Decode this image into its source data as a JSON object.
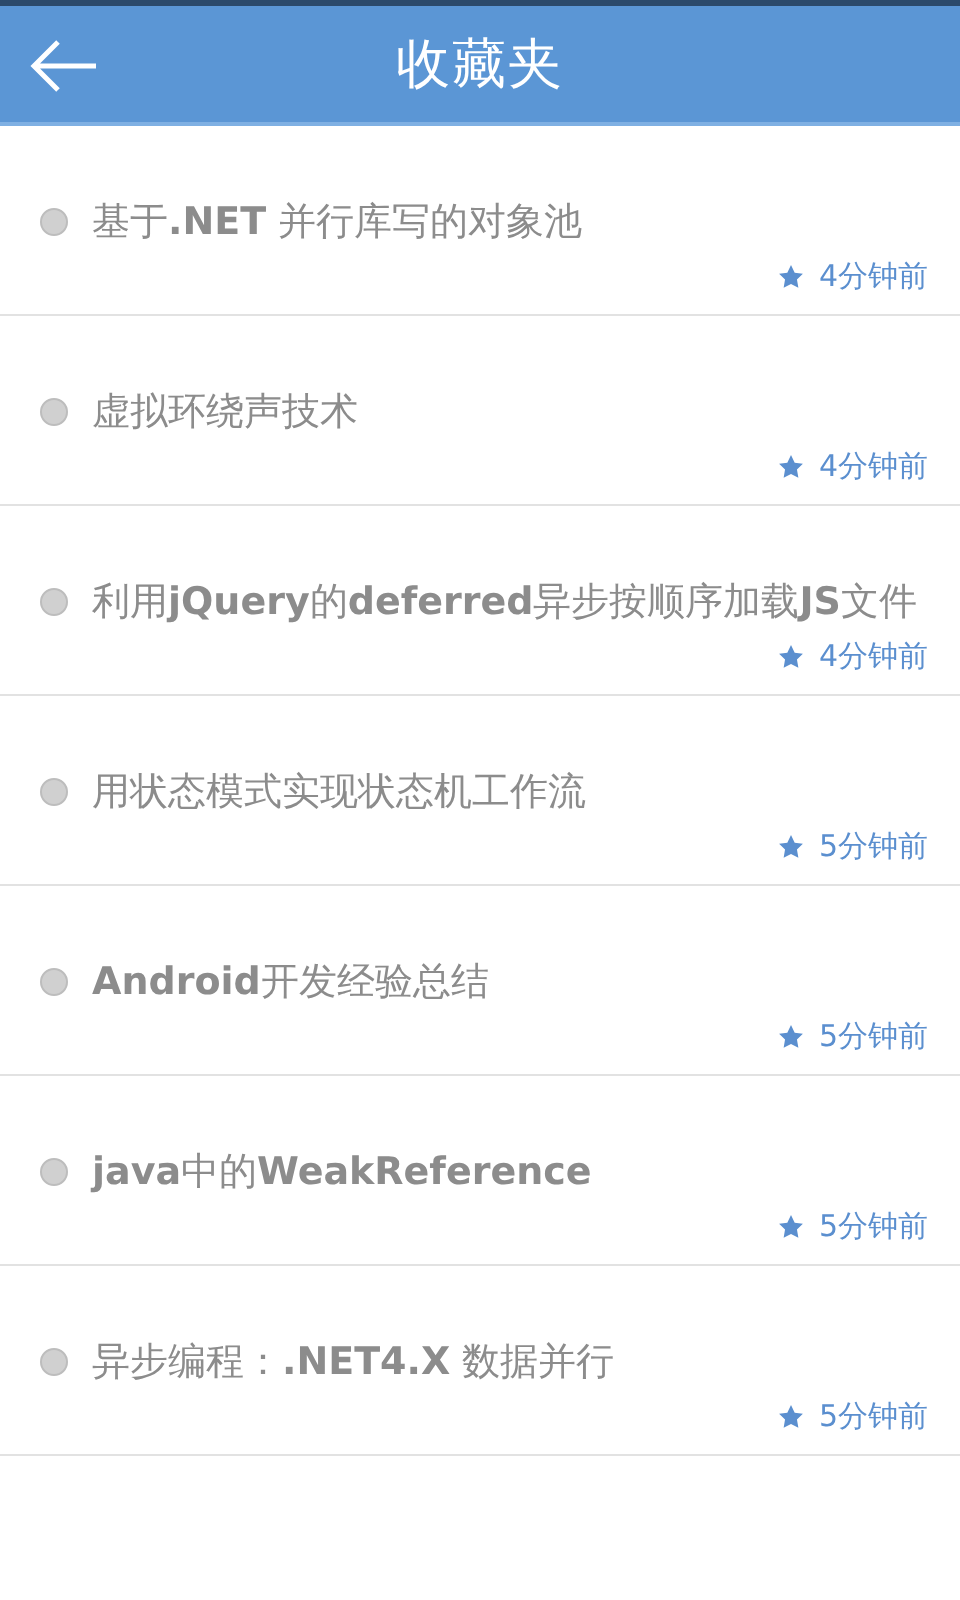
{
  "header": {
    "title": "收藏夹"
  },
  "favorites": [
    {
      "title": "基于**.NET** 并行库写的对象池",
      "time": "4分钟前"
    },
    {
      "title": "虚拟环绕声技术",
      "time": "4分钟前"
    },
    {
      "title": "利用**jQuery**的**deferred**异步按顺序加载**JS**文件",
      "time": "4分钟前"
    },
    {
      "title": "用状态模式实现状态机工作流",
      "time": "5分钟前"
    },
    {
      "title": "**Android**开发经验总结",
      "time": "5分钟前"
    },
    {
      "title": "**java**中的**WeakReference**",
      "time": "5分钟前"
    },
    {
      "title": "异步编程：**.NET4.X** 数据并行",
      "time": "5分钟前"
    }
  ]
}
